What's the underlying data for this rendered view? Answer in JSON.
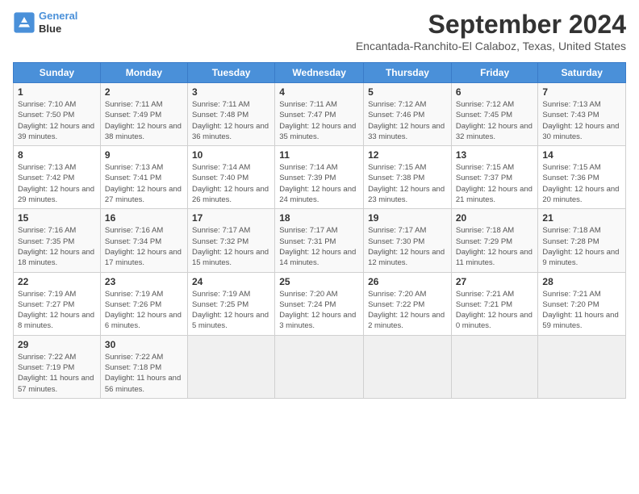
{
  "header": {
    "logo_line1": "General",
    "logo_line2": "Blue",
    "title": "September 2024",
    "subtitle": "Encantada-Ranchito-El Calaboz, Texas, United States"
  },
  "days_of_week": [
    "Sunday",
    "Monday",
    "Tuesday",
    "Wednesday",
    "Thursday",
    "Friday",
    "Saturday"
  ],
  "weeks": [
    [
      {
        "day": 1,
        "sunrise": "7:10 AM",
        "sunset": "7:50 PM",
        "daylight": "12 hours and 39 minutes."
      },
      {
        "day": 2,
        "sunrise": "7:11 AM",
        "sunset": "7:49 PM",
        "daylight": "12 hours and 38 minutes."
      },
      {
        "day": 3,
        "sunrise": "7:11 AM",
        "sunset": "7:48 PM",
        "daylight": "12 hours and 36 minutes."
      },
      {
        "day": 4,
        "sunrise": "7:11 AM",
        "sunset": "7:47 PM",
        "daylight": "12 hours and 35 minutes."
      },
      {
        "day": 5,
        "sunrise": "7:12 AM",
        "sunset": "7:46 PM",
        "daylight": "12 hours and 33 minutes."
      },
      {
        "day": 6,
        "sunrise": "7:12 AM",
        "sunset": "7:45 PM",
        "daylight": "12 hours and 32 minutes."
      },
      {
        "day": 7,
        "sunrise": "7:13 AM",
        "sunset": "7:43 PM",
        "daylight": "12 hours and 30 minutes."
      }
    ],
    [
      {
        "day": 8,
        "sunrise": "7:13 AM",
        "sunset": "7:42 PM",
        "daylight": "12 hours and 29 minutes."
      },
      {
        "day": 9,
        "sunrise": "7:13 AM",
        "sunset": "7:41 PM",
        "daylight": "12 hours and 27 minutes."
      },
      {
        "day": 10,
        "sunrise": "7:14 AM",
        "sunset": "7:40 PM",
        "daylight": "12 hours and 26 minutes."
      },
      {
        "day": 11,
        "sunrise": "7:14 AM",
        "sunset": "7:39 PM",
        "daylight": "12 hours and 24 minutes."
      },
      {
        "day": 12,
        "sunrise": "7:15 AM",
        "sunset": "7:38 PM",
        "daylight": "12 hours and 23 minutes."
      },
      {
        "day": 13,
        "sunrise": "7:15 AM",
        "sunset": "7:37 PM",
        "daylight": "12 hours and 21 minutes."
      },
      {
        "day": 14,
        "sunrise": "7:15 AM",
        "sunset": "7:36 PM",
        "daylight": "12 hours and 20 minutes."
      }
    ],
    [
      {
        "day": 15,
        "sunrise": "7:16 AM",
        "sunset": "7:35 PM",
        "daylight": "12 hours and 18 minutes."
      },
      {
        "day": 16,
        "sunrise": "7:16 AM",
        "sunset": "7:34 PM",
        "daylight": "12 hours and 17 minutes."
      },
      {
        "day": 17,
        "sunrise": "7:17 AM",
        "sunset": "7:32 PM",
        "daylight": "12 hours and 15 minutes."
      },
      {
        "day": 18,
        "sunrise": "7:17 AM",
        "sunset": "7:31 PM",
        "daylight": "12 hours and 14 minutes."
      },
      {
        "day": 19,
        "sunrise": "7:17 AM",
        "sunset": "7:30 PM",
        "daylight": "12 hours and 12 minutes."
      },
      {
        "day": 20,
        "sunrise": "7:18 AM",
        "sunset": "7:29 PM",
        "daylight": "12 hours and 11 minutes."
      },
      {
        "day": 21,
        "sunrise": "7:18 AM",
        "sunset": "7:28 PM",
        "daylight": "12 hours and 9 minutes."
      }
    ],
    [
      {
        "day": 22,
        "sunrise": "7:19 AM",
        "sunset": "7:27 PM",
        "daylight": "12 hours and 8 minutes."
      },
      {
        "day": 23,
        "sunrise": "7:19 AM",
        "sunset": "7:26 PM",
        "daylight": "12 hours and 6 minutes."
      },
      {
        "day": 24,
        "sunrise": "7:19 AM",
        "sunset": "7:25 PM",
        "daylight": "12 hours and 5 minutes."
      },
      {
        "day": 25,
        "sunrise": "7:20 AM",
        "sunset": "7:24 PM",
        "daylight": "12 hours and 3 minutes."
      },
      {
        "day": 26,
        "sunrise": "7:20 AM",
        "sunset": "7:22 PM",
        "daylight": "12 hours and 2 minutes."
      },
      {
        "day": 27,
        "sunrise": "7:21 AM",
        "sunset": "7:21 PM",
        "daylight": "12 hours and 0 minutes."
      },
      {
        "day": 28,
        "sunrise": "7:21 AM",
        "sunset": "7:20 PM",
        "daylight": "11 hours and 59 minutes."
      }
    ],
    [
      {
        "day": 29,
        "sunrise": "7:22 AM",
        "sunset": "7:19 PM",
        "daylight": "11 hours and 57 minutes."
      },
      {
        "day": 30,
        "sunrise": "7:22 AM",
        "sunset": "7:18 PM",
        "daylight": "11 hours and 56 minutes."
      },
      null,
      null,
      null,
      null,
      null
    ]
  ]
}
